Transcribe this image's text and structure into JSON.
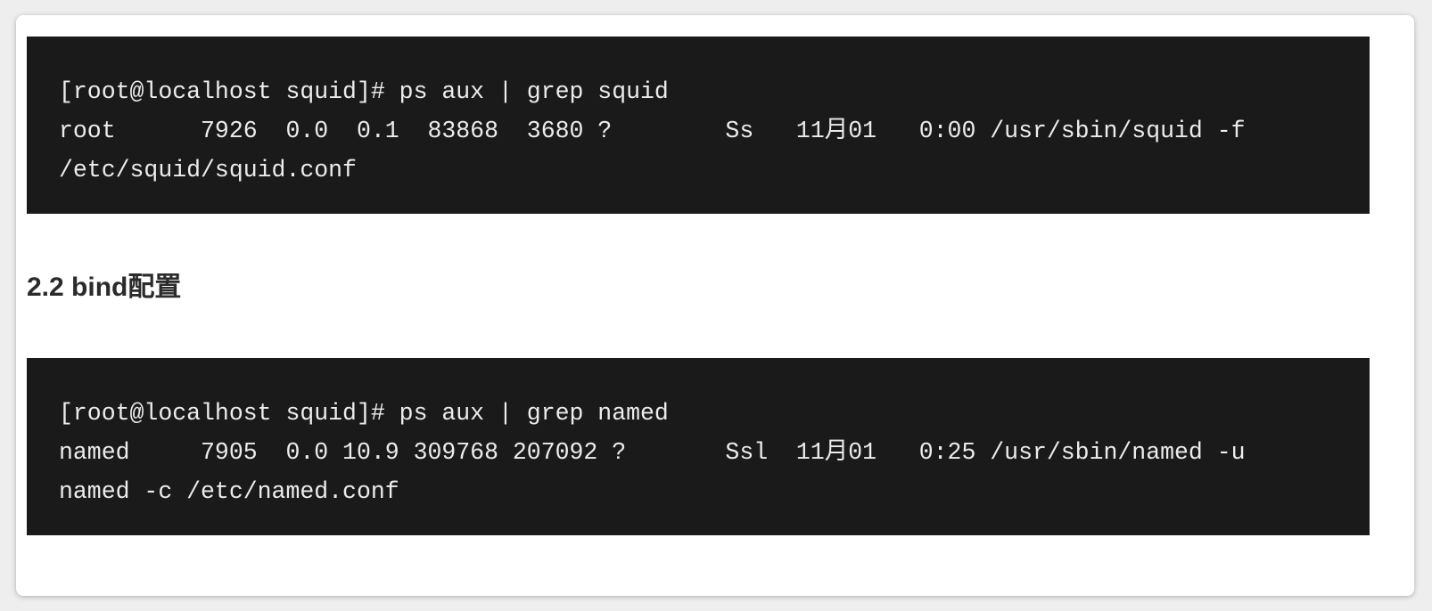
{
  "code_blocks": [
    {
      "lines": [
        "[root@localhost squid]# ps aux | grep squid",
        "root      7926  0.0  0.1  83868  3680 ?        Ss   11月01   0:00 /usr/sbin/squid -f",
        "/etc/squid/squid.conf"
      ]
    },
    {
      "lines": [
        "[root@localhost squid]# ps aux | grep named",
        "named     7905  0.0 10.9 309768 207092 ?       Ssl  11月01   0:25 /usr/sbin/named -u",
        "named -c /etc/named.conf"
      ]
    }
  ],
  "heading": "2.2 bind配置",
  "colors": {
    "code_background": "#1a1a1a",
    "code_text": "#ececec",
    "heading_text": "#2b2b2b",
    "card_background": "#ffffff"
  }
}
